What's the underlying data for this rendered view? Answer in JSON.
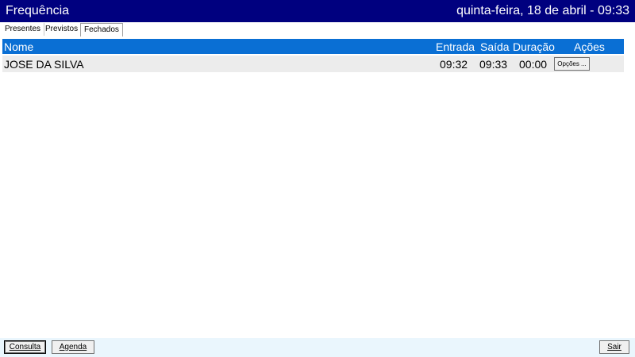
{
  "window": {
    "title": "Frequência",
    "datetime": "quinta-feira, 18 de abril - 09:33"
  },
  "tabs": [
    {
      "label": "Presentes",
      "active": false
    },
    {
      "label": "Previstos",
      "active": false
    },
    {
      "label": "Fechados",
      "active": true
    }
  ],
  "grid": {
    "columns": {
      "nome": "Nome",
      "entrada": "Entrada",
      "saida": "Saída",
      "duracao": "Duração",
      "acoes": "Ações"
    },
    "rows": [
      {
        "nome": "JOSE DA SILVA",
        "entrada": "09:32",
        "saida": "09:33",
        "duracao": "00:00",
        "acoes_label": "Opções ..."
      }
    ]
  },
  "footer": {
    "consulta_label": "Consulta",
    "agenda_label": "Agenda",
    "sair_label": "Sair"
  },
  "colors": {
    "titlebar": "#00007f",
    "grid_header": "#0a6fd4",
    "row_background": "#ececec",
    "statusbar": "#eaf6fd"
  }
}
